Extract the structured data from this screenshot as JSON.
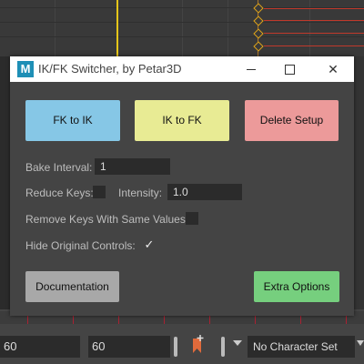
{
  "window": {
    "title": "IK/FK Switcher, by Petar3D",
    "app_icon": "M",
    "minimize_label": "",
    "maximize_label": "",
    "close_label": "✕"
  },
  "buttons": {
    "fk_to_ik": "FK to IK",
    "ik_to_fk": "IK to FK",
    "delete_setup": "Delete Setup",
    "documentation": "Documentation",
    "extra_options": "Extra Options"
  },
  "settings": {
    "bake_interval_label": "Bake Interval:",
    "bake_interval_value": "1",
    "reduce_keys_label": "Reduce Keys:",
    "reduce_keys_checked": false,
    "intensity_label": "Intensity:",
    "intensity_value": "1.0",
    "remove_keys_label": "Remove Keys With Same Values:",
    "remove_keys_checked": false,
    "hide_original_label": "Hide Original Controls:",
    "hide_original_checked": true,
    "check_glyph": "✓"
  },
  "bottom_bar": {
    "start_frame": "60",
    "end_frame": "60",
    "character_set": "No Character Set"
  },
  "colors": {
    "fk_to_ik": "#86c7e6",
    "ik_to_fk": "#e8eb94",
    "delete_setup": "#ec9a9a",
    "documentation": "#a8a8a8",
    "extra_options": "#76cf7e"
  }
}
